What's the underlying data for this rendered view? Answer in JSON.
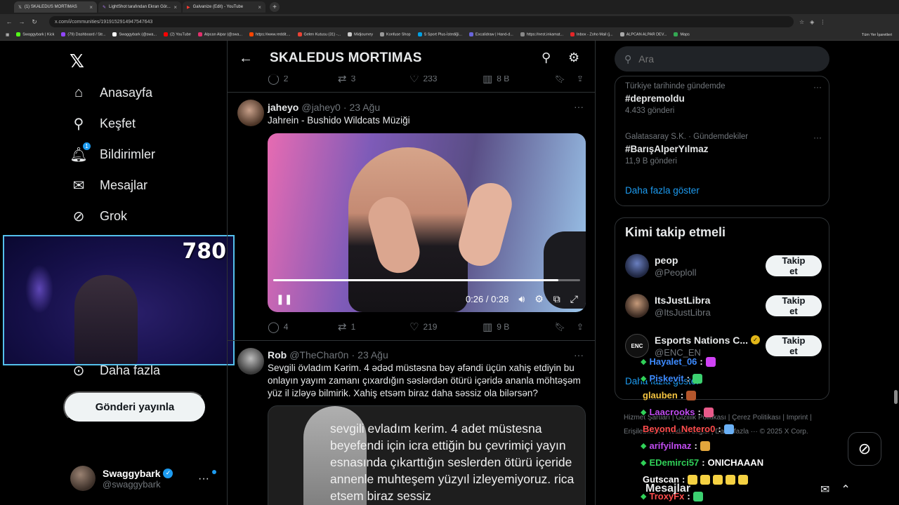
{
  "browser": {
    "tabs": [
      {
        "title": "(1) SKALEDUS MORTIMAS",
        "active": true
      },
      {
        "title": "LightShot tarafından Ekran Gör...",
        "active": false
      },
      {
        "title": "Galvanize (Edit) - YouTube",
        "active": false
      }
    ],
    "url": "x.com/i/communities/1919152914947547643",
    "bookmarks": [
      "Swaggybark | Kick",
      "(79) Dashboard / Str...",
      "Swaggybark (@swa...",
      "(2) YouTube",
      "Alpcan Alpar (@swa...",
      "https://www.reddit....",
      "Gelen Kutusu (31) -...",
      "Midjourney",
      "Konfuse Shop",
      "S Sport Plus-İstediği...",
      "Excalidraw | Hand-d...",
      "https://nest.inkamat...",
      "Inbox - Zoho Mail (j...",
      "ALPCAN ALPAR DEV...",
      "Maps"
    ],
    "bookmarks_right": "Tüm Yer İşaretleri"
  },
  "nav": {
    "items": [
      {
        "label": "Anasayfa",
        "icon": "home-icon"
      },
      {
        "label": "Keşfet",
        "icon": "search-icon"
      },
      {
        "label": "Bildirimler",
        "icon": "bell-icon",
        "badge": "1"
      },
      {
        "label": "Mesajlar",
        "icon": "mail-icon"
      },
      {
        "label": "Grok",
        "icon": "grok-icon"
      },
      {
        "label": "Daha fazla",
        "icon": "more-icon"
      }
    ],
    "post_button": "Gönderi yayınla",
    "profile": {
      "name": "Swaggybark",
      "handle": "@swaggybark"
    }
  },
  "webcam": {
    "count": "780"
  },
  "main": {
    "title": "SKALEDUS MORTIMAS",
    "top_actions": {
      "replies": "2",
      "reposts": "3",
      "likes": "233",
      "views": "8 B"
    },
    "tweets": [
      {
        "name": "jaheyo",
        "handle": "@jahey0",
        "date": "23 Ağu",
        "text": "Jahrein - Bushido Wildcats Müziği",
        "video": {
          "time": "0:26 / 0:28",
          "progress": 0.93
        },
        "actions": {
          "replies": "4",
          "reposts": "1",
          "likes": "219",
          "views": "9 B"
        }
      },
      {
        "name": "Rob",
        "handle": "@TheChar0n",
        "date": "23 Ağu",
        "text": "Sevgili övladım Kərim. 4 ədəd müstəsna bəy əfəndi üçün xahiş etdiyin bu onlayın yayım zamanı çıxardığın səslərdən ötürü içəridə ananla möhtəşəm yüz il izləyə bilmirik. Xahiş etsəm biraz daha səssiz ola bilərsən?",
        "image_text": "sevgili evladım kerim. 4 adet müstesna beyefendi için icra ettiğin bu çevrimiçi yayın esnasında çıkarttığın seslerden ötürü içeride annenle muhteşem yüzyıl izleyemiyoruz. rica etsem biraz sessiz"
      }
    ]
  },
  "right": {
    "search_placeholder": "Ara",
    "trends": [
      {
        "context": "Türkiye tarihinde gündemde",
        "tag": "#depremoldu",
        "count": "4.433 gönderi"
      },
      {
        "context": "Galatasaray S.K. · Gündemdekiler",
        "tag": "#BarışAlperYılmaz",
        "count": "11,9 B gönderi"
      }
    ],
    "show_more": "Daha fazla göster",
    "who_to_follow": {
      "title": "Kimi takip etmeli",
      "accounts": [
        {
          "name": "peop",
          "handle": "@Peoploll",
          "button": "Takip et"
        },
        {
          "name": "ItsJustLibra",
          "handle": "@ItsJustLibra",
          "button": "Takip et"
        },
        {
          "name": "Esports Nations C...",
          "handle": "@ENC_EN",
          "button": "Takip et"
        }
      ],
      "show_more": "Daha fazla göster"
    },
    "footer": "Hizmet Şartları | Gizlilik Politikası | Çerez Politikası | Imprint | Erişilebilirlik | Reklam bilgisi | Daha fazla ··· © 2025 X Corp."
  },
  "chat": [
    {
      "user": "Hayalet_06",
      "color": "#3d8bff",
      "msg": ""
    },
    {
      "user": "Piskevit",
      "color": "#3d8bff",
      "msg": ""
    },
    {
      "user": "glauben",
      "color": "#f5c542",
      "msg": ""
    },
    {
      "user": "Laacrooks",
      "color": "#c04cf0",
      "msg": ""
    },
    {
      "user": "Beyond_Netero0",
      "color": "#ff4d4d",
      "msg": ""
    },
    {
      "user": "arifyilmaz",
      "color": "#c04cf0",
      "msg": ""
    },
    {
      "user": "EDemirci57",
      "color": "#30d158",
      "msg": "ONICHAAAN"
    },
    {
      "user": "Gutscan",
      "color": "#ffffff",
      "msg": ""
    },
    {
      "user": "TroxyFx",
      "color": "#ff4d4d",
      "msg": ""
    }
  ],
  "messages_drawer": {
    "label": "Mesajlar"
  }
}
